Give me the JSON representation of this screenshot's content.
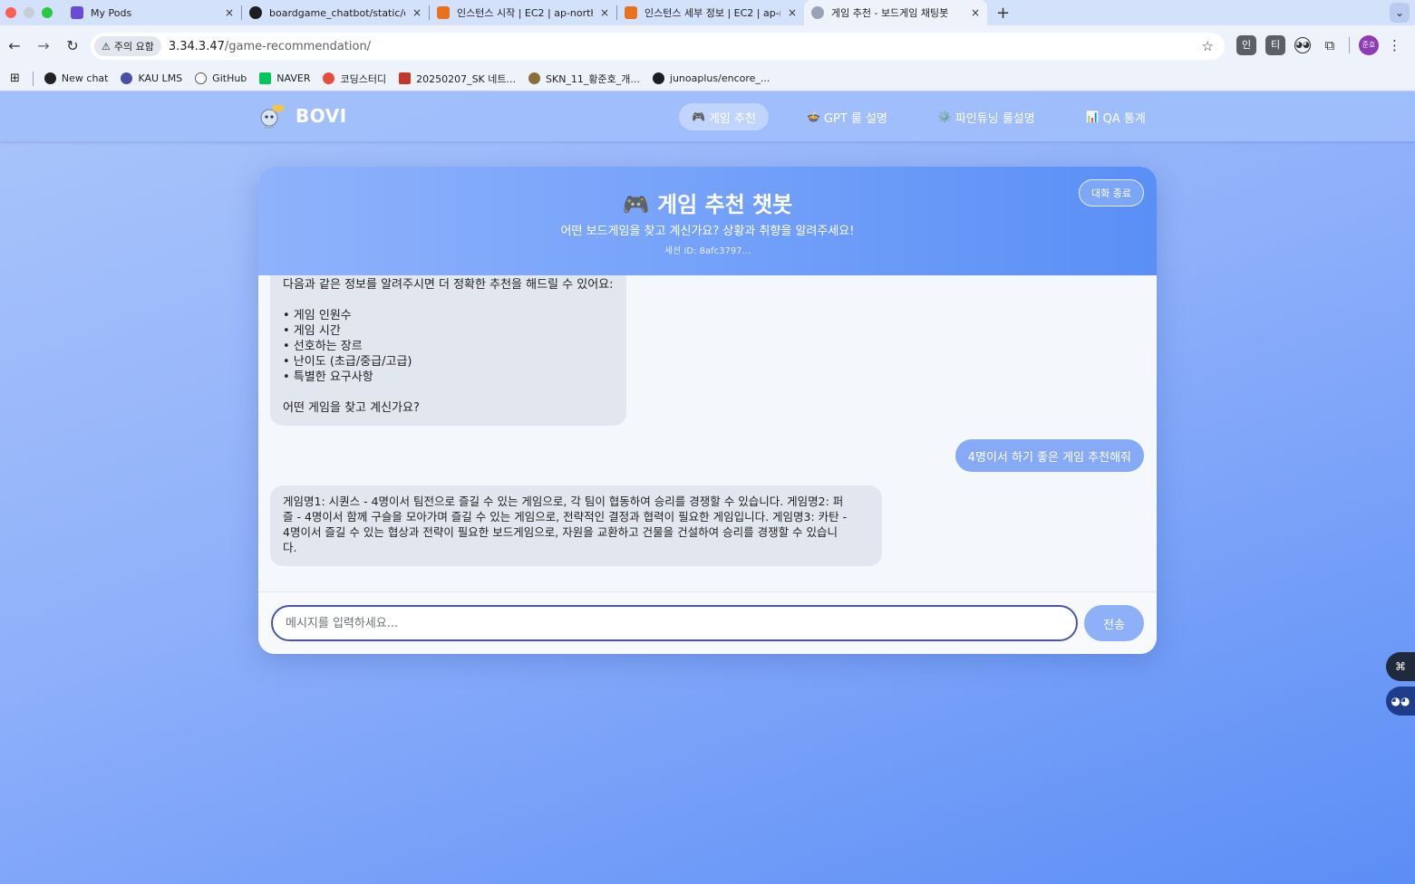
{
  "browser": {
    "tabs": [
      {
        "title": "My Pods",
        "icon_color": "#6a4bd6",
        "active": false
      },
      {
        "title": "boardgame_chatbot/static/ch",
        "icon_color": "#1b1f23",
        "active": false
      },
      {
        "title": "인스턴스 시작 | EC2 | ap-northe",
        "icon_color": "#e8711c",
        "active": false
      },
      {
        "title": "인스턴스 세부 정보 | EC2 | ap-no",
        "icon_color": "#e8711c",
        "active": false
      },
      {
        "title": "게임 추천 - 보드게임 채팅봇",
        "icon_color": "#9aa3b5",
        "active": true
      }
    ],
    "tab_close_glyph": "×",
    "new_tab_glyph": "+",
    "warning_label": "주의 요함",
    "url_host": "3.34.3.47",
    "url_path": "/game-recommendation/",
    "extensions": [
      "인",
      "티"
    ],
    "profile_label": "준호",
    "bookmarks": [
      {
        "label": "New chat",
        "icon_color": "#222"
      },
      {
        "label": "KAU LMS",
        "icon_color": "#4b4fa3"
      },
      {
        "label": "GitHub",
        "icon_color": "#444"
      },
      {
        "label": "NAVER",
        "icon_color": "#03c75a"
      },
      {
        "label": "코딩스터디",
        "icon_color": "#e84b3c"
      },
      {
        "label": "20250207_SK 네트...",
        "icon_color": "#c0392b"
      },
      {
        "label": "SKN_11_황준호_개...",
        "icon_color": "#8a6d3b"
      },
      {
        "label": "junoaplus/encore_...",
        "icon_color": "#1b1f23"
      }
    ]
  },
  "site": {
    "logo_text": "BOVI",
    "logo_badge": "BOVI",
    "nav": [
      {
        "icon": "🎮",
        "label": "게임 추천",
        "active": true
      },
      {
        "icon": "🍲",
        "label": "GPT 룰 설명",
        "active": false
      },
      {
        "icon": "⚙️",
        "label": "파인튜닝 룰설명",
        "active": false
      },
      {
        "icon": "📊",
        "label": "QA 통계",
        "active": false
      }
    ]
  },
  "chat": {
    "title": "🎮 게임 추천 챗봇",
    "subtitle": "어떤 보드게임을 찾고 계신가요? 상황과 취향을 알려주세요!",
    "session": "세션 ID: 8afc3797...",
    "end_button": "대화 종료",
    "bot_intro_lines": [
      "다음과 같은 정보를 알려주시면 더 정확한 추천을 해드릴 수 있어요:",
      "",
      "• 게임 인원수",
      "• 게임 시간",
      "• 선호하는 장르",
      "• 난이도 (초급/중급/고급)",
      "• 특별한 요구사항",
      "",
      "어떤 게임을 찾고 계신가요?"
    ],
    "user_message": "4명이서 하기 좋은 게임 추천해줘",
    "bot_reply_lines": [
      "게임명1: 시퀀스 - 4명이서 팀전으로 즐길 수 있는 게임으로, 각 팀이 협동하여 승리를 경쟁할 수 있습니다. 게임명2: 퍼",
      "즐 - 4명이서 함께 구슬을 모아가며 즐길 수 있는 게임으로, 전략적인 결정과 협력이 필요한 게임입니다. 게임명3: 카탄 -",
      "4명이서 즐길 수 있는 협상과 전략이 필요한 보드게임으로, 자원을 교환하고 건물을 건설하여 승리를 경쟁할 수 있습니",
      "다."
    ],
    "input_placeholder": "메시지를 입력하세요...",
    "send_label": "전송"
  }
}
